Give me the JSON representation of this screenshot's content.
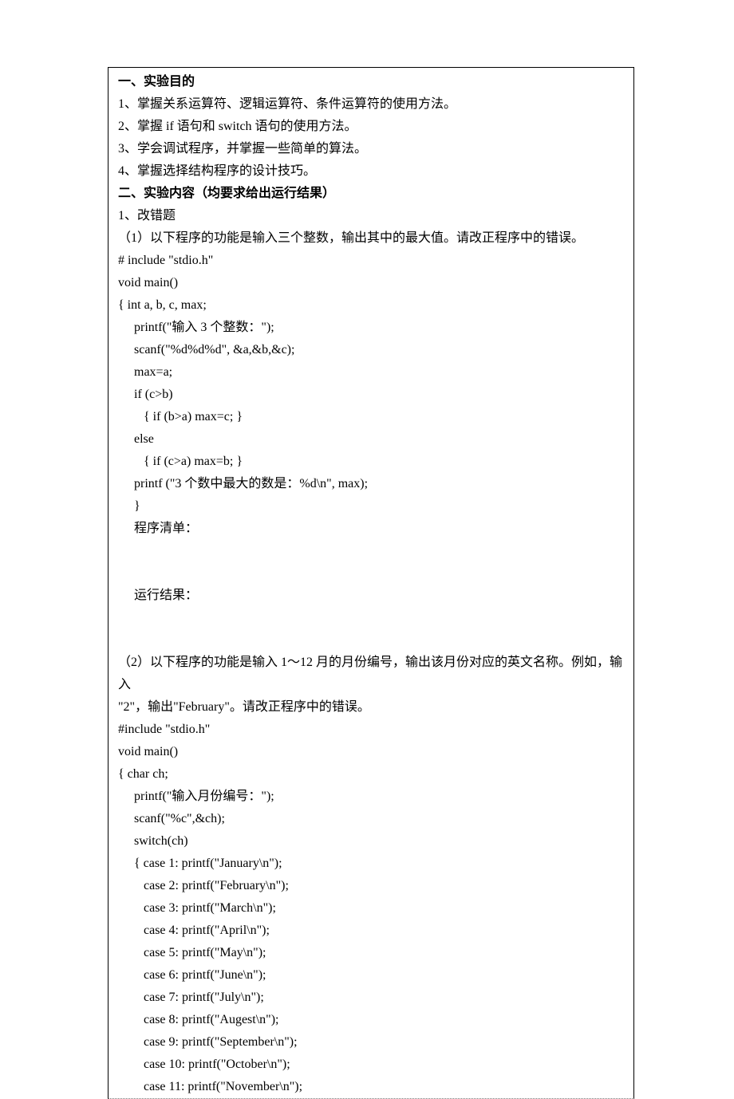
{
  "section1": {
    "heading": "一、实验目的",
    "items": [
      "1、掌握关系运算符、逻辑运算符、条件运算符的使用方法。",
      "2、掌握 if 语句和 switch 语句的使用方法。",
      "3、学会调试程序，并掌握一些简单的算法。",
      "4、掌握选择结构程序的设计技巧。"
    ]
  },
  "section2": {
    "heading": "二、实验内容（均要求给出运行结果）",
    "q1_label": "1、改错题",
    "q1_desc": "（1）以下程序的功能是输入三个整数，输出其中的最大值。请改正程序中的错误。",
    "code1": {
      "l1": "# include \"stdio.h\"",
      "l2": "void main()",
      "l3": "{ int a, b, c, max;",
      "l4": "printf(\"输入 3 个整数：\");",
      "l5": "scanf(\"%d%d%d\", &a,&b,&c);",
      "l6": "max=a;",
      "l7": "if (c>b)",
      "l8": "{ if (b>a) max=c; }",
      "l9": "else",
      "l10": "{ if (c>a) max=b; }",
      "l11": "printf (\"3 个数中最大的数是：%d\\n\", max);",
      "l12": "}"
    },
    "listing_label": "程序清单：",
    "result_label": "运行结果：",
    "q2_desc_a": "（2）以下程序的功能是输入 1～12 月的月份编号，输出该月份对应的英文名称。例如，输入",
    "q2_desc_b": "\"2\"，输出\"February\"。请改正程序中的错误。",
    "code2": {
      "l1": "#include \"stdio.h\"",
      "l2": "void main()",
      "l3": "{ char ch;",
      "l4": "printf(\"输入月份编号：\");",
      "l5": "scanf(\"%c\",&ch);",
      "l6": "switch(ch)",
      "l7": "{ case 1: printf(\"January\\n\");",
      "l8": "case 2: printf(\"February\\n\");",
      "l9": "case 3: printf(\"March\\n\");",
      "l10": "case 4: printf(\"April\\n\");",
      "l11": "case 5: printf(\"May\\n\");",
      "l12": "case 6: printf(\"June\\n\");",
      "l13": "case 7: printf(\"July\\n\");",
      "l14": "case 8: printf(\"Augest\\n\");",
      "l15": "case 9: printf(\"September\\n\");",
      "l16": "case 10: printf(\"October\\n\");",
      "l17": "case 11: printf(\"November\\n\");"
    }
  }
}
